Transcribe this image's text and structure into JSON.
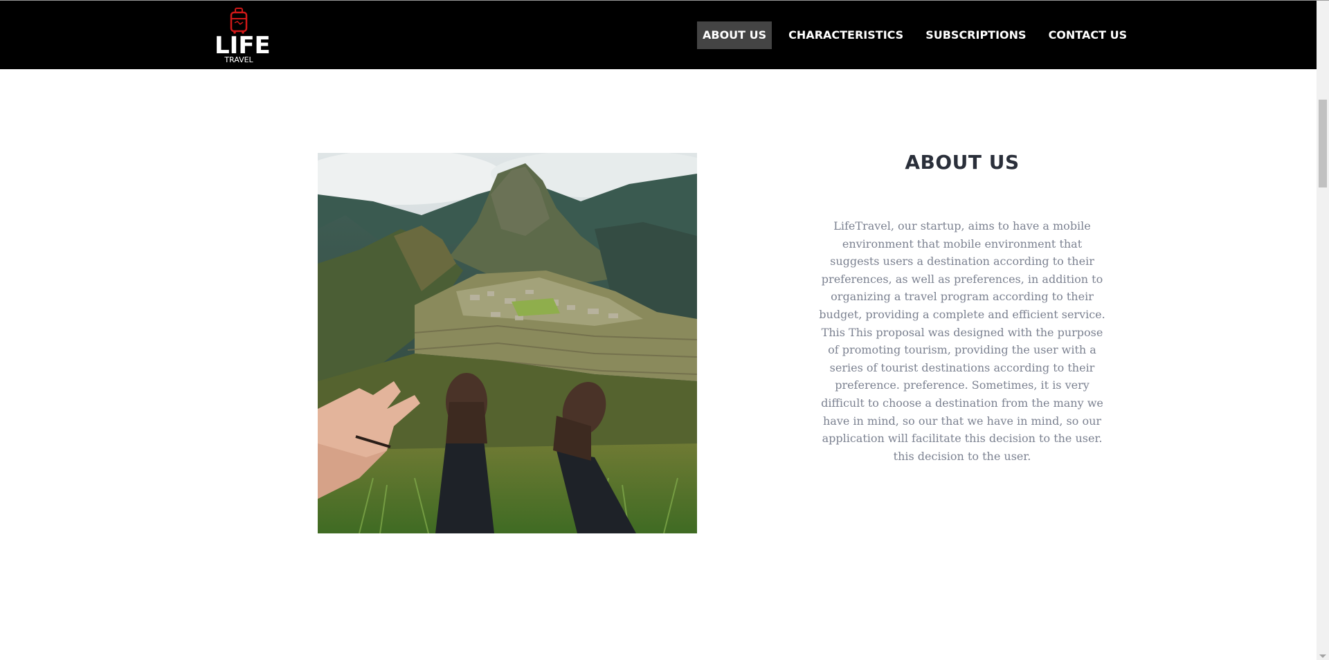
{
  "logo": {
    "main": "LIFE",
    "sub": "TRAVEL",
    "icon": "suitcase-icon",
    "accent_color": "#d01818"
  },
  "nav": {
    "items": [
      {
        "label": "ABOUT US",
        "active": true
      },
      {
        "label": "CHARACTERISTICS",
        "active": false
      },
      {
        "label": "SUBSCRIPTIONS",
        "active": false
      },
      {
        "label": "CONTACT US",
        "active": false
      }
    ]
  },
  "about": {
    "title": "ABOUT US",
    "body": "LifeTravel, our startup, aims to have a mobile environment that mobile environment that suggests users a destination according to their preferences, as well as preferences, in addition to organizing a travel program according to their budget, providing a complete and efficient service. This This proposal was designed with the purpose of promoting tourism, providing the user with a series of tourist destinations according to their preference. preference. Sometimes, it is very difficult to choose a destination from the many we have in mind, so our that we have in mind, so our application will facilitate this decision to the user. this decision to the user.",
    "image": "mountain-ruins-photo"
  },
  "colors": {
    "navbar": "#000000",
    "nav_active": "#444444",
    "title": "#2a2f3a",
    "body_text": "#7b8190"
  }
}
